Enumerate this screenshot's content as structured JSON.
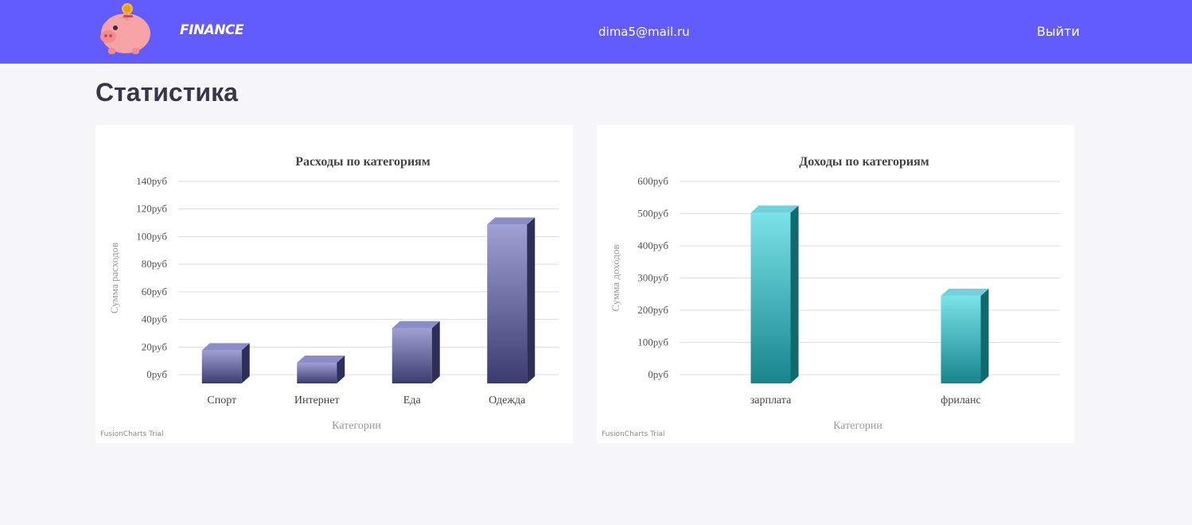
{
  "header": {
    "brand": "FINANCE",
    "user_email": "dima5@mail.ru",
    "logout_label": "Выйти"
  },
  "page": {
    "title": "Статистика"
  },
  "trial_label": "FusionCharts Trial",
  "colors": {
    "header_bg": "#615cfb",
    "expense_bar_top": "#9fa0d3",
    "expense_bar_bottom": "#3a3b6e",
    "income_bar_top": "#7be3ea",
    "income_bar_bottom": "#17858c"
  },
  "chart_data": [
    {
      "type": "bar",
      "title": "Расходы по категориям",
      "xlabel": "Категории",
      "ylabel": "Сумма расходов",
      "categories": [
        "Спорт",
        "Интернет",
        "Еда",
        "Одежда"
      ],
      "values": [
        24,
        15,
        40,
        115
      ],
      "ylim": [
        0,
        140
      ],
      "yticks": [
        "0руб",
        "20руб",
        "40руб",
        "60руб",
        "80руб",
        "100руб",
        "120руб",
        "140руб"
      ],
      "tick_step": 20,
      "grid": true,
      "style": "3d-column"
    },
    {
      "type": "bar",
      "title": "Доходы по категориям",
      "xlabel": "Категории",
      "ylabel": "Сумма доходов",
      "categories": [
        "зарплата",
        "фриланс"
      ],
      "values": [
        530,
        272
      ],
      "ylim": [
        0,
        600
      ],
      "yticks": [
        "0руб",
        "100руб",
        "200руб",
        "300руб",
        "400руб",
        "500руб",
        "600руб"
      ],
      "tick_step": 100,
      "grid": true,
      "style": "3d-column"
    }
  ]
}
